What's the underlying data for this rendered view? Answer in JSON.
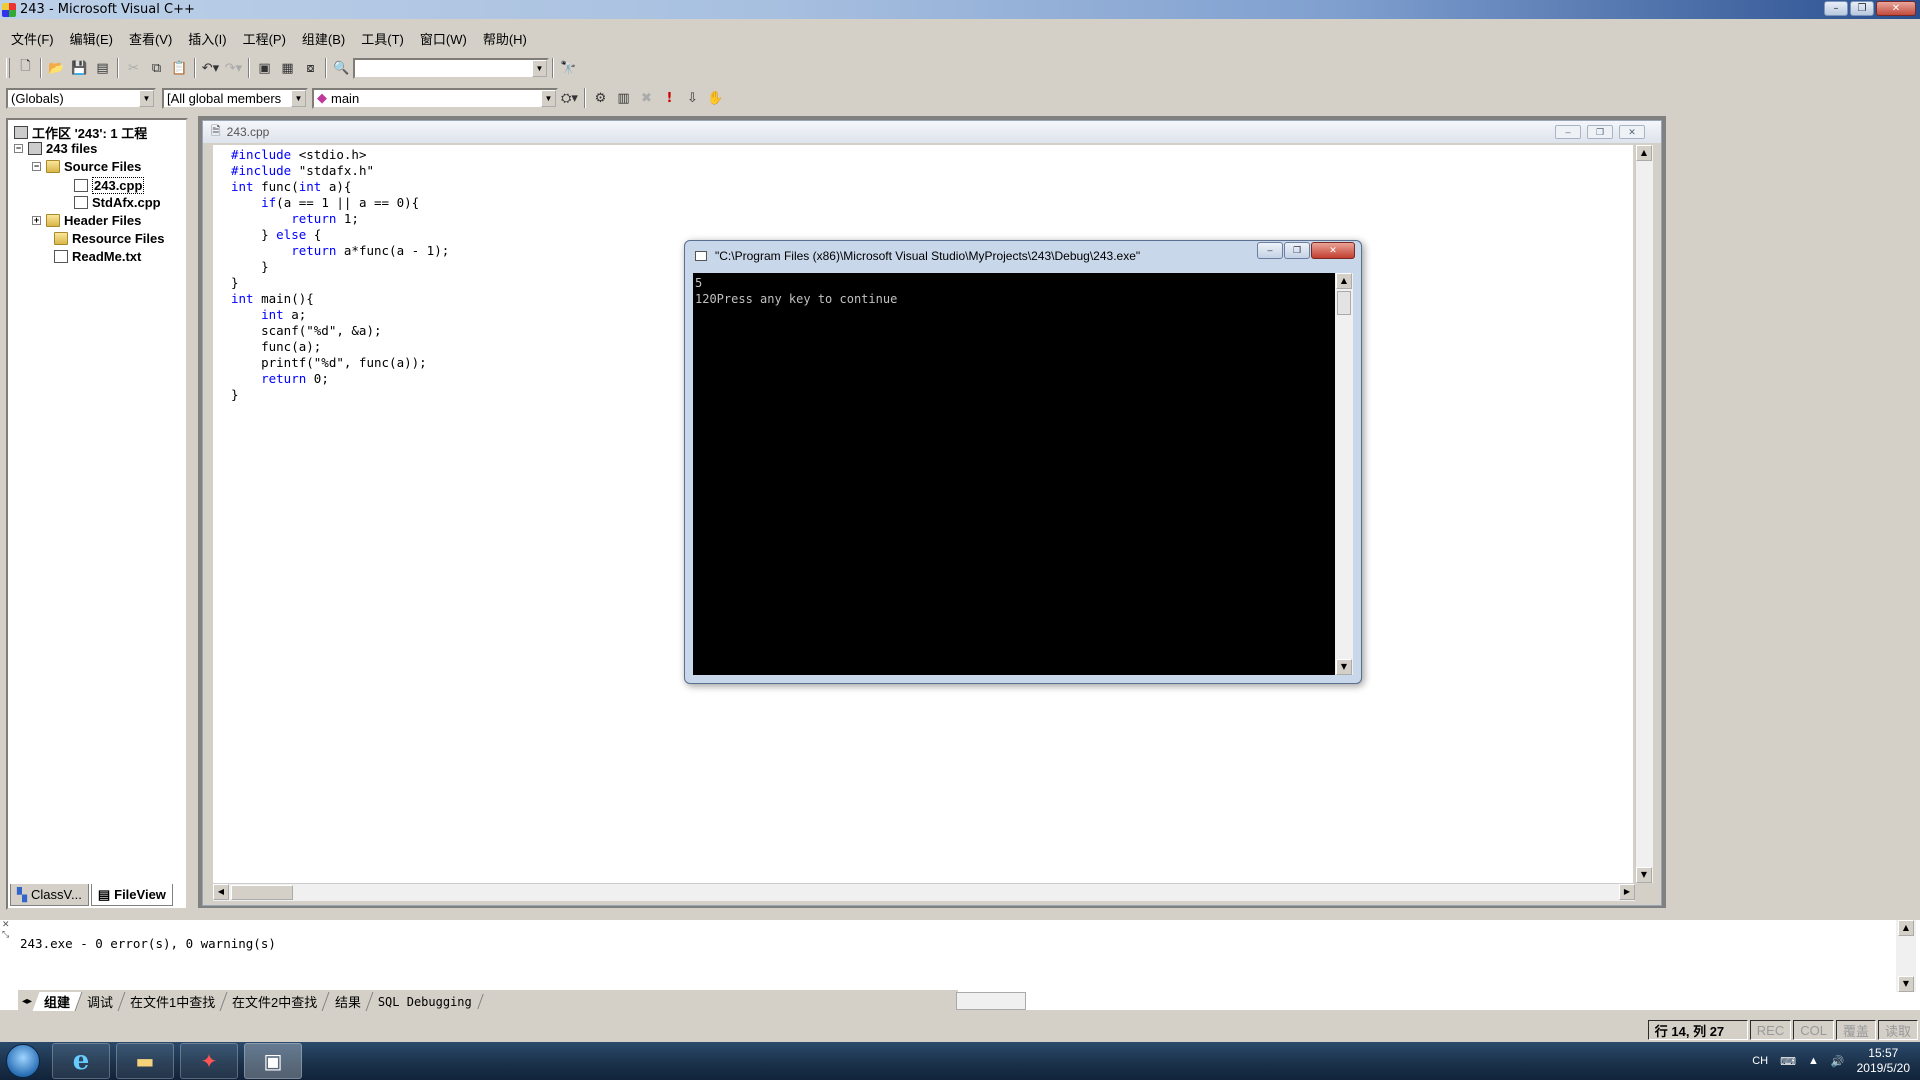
{
  "window": {
    "title": "243 - Microsoft Visual C++"
  },
  "menu": [
    "文件(F)",
    "编辑(E)",
    "查看(V)",
    "插入(I)",
    "工程(P)",
    "组建(B)",
    "工具(T)",
    "窗口(W)",
    "帮助(H)"
  ],
  "toolbar": {
    "find_value": ""
  },
  "wizardbar": {
    "class_combo": "(Globals)",
    "filter_combo": "[All global members",
    "member_combo": "main"
  },
  "workspace": {
    "root": "工作区 '243': 1 工程",
    "project": "243 files",
    "source_folder": "Source Files",
    "file1": "243.cpp",
    "file2": "StdAfx.cpp",
    "header_folder": "Header Files",
    "resource_folder": "Resource Files",
    "readme": "ReadMe.txt",
    "tabs": {
      "classview": "ClassV...",
      "fileview": "FileView"
    }
  },
  "editor": {
    "title": "243.cpp",
    "lines": [
      "#include <stdio.h>",
      "#include \"stdafx.h\"",
      "int func(int a){",
      "    if(a == 1 || a == 0){",
      "        return 1;",
      "    } else {",
      "        return a*func(a - 1);",
      "    }",
      "}",
      "int main(){",
      "    int a;",
      "    scanf(\"%d\", &a);",
      "    func(a);",
      "    printf(\"%d\", func(a));",
      "    return 0;",
      "}"
    ]
  },
  "console": {
    "title": "\"C:\\Program Files (x86)\\Microsoft Visual Studio\\MyProjects\\243\\Debug\\243.exe\"",
    "line1": "5",
    "line2": "120Press any key to continue"
  },
  "output": {
    "text": "243.exe - 0 error(s), 0 warning(s)",
    "tabs": [
      "组建",
      "调试",
      "在文件1中查找",
      "在文件2中查找",
      "结果",
      "SQL Debugging"
    ]
  },
  "statusbar": {
    "position": "行 14, 列 27",
    "rec": "REC",
    "col": "COL",
    "ovr": "覆盖",
    "read": "读取"
  },
  "taskbar": {
    "ime": "CH",
    "time": "15:57",
    "date": "2019/5/20"
  }
}
